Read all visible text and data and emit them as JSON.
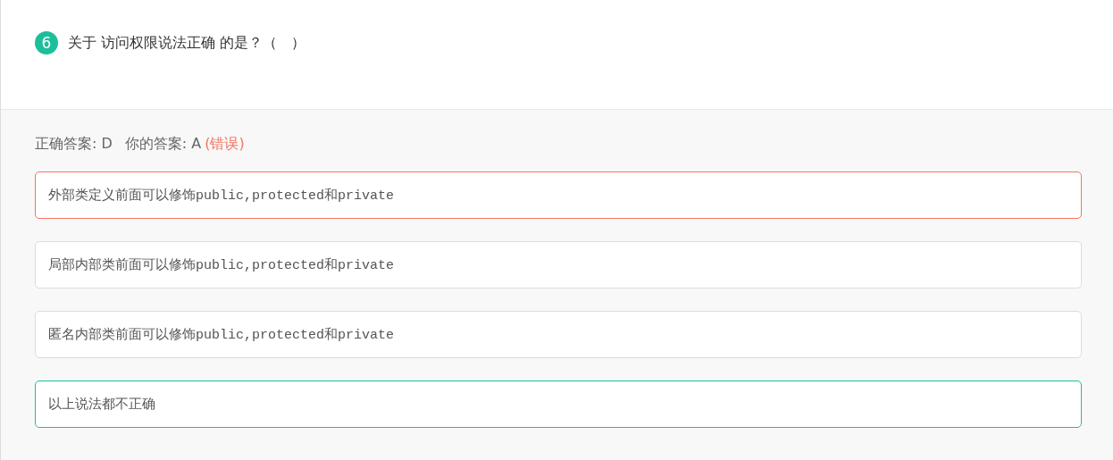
{
  "question": {
    "number": "6",
    "text": "关于 访问权限说法正确 的是？（　）"
  },
  "result": {
    "correct_answer": "正确答案: D",
    "your_answer": "你的答案: A",
    "verdict": "(错误)"
  },
  "options": [
    {
      "text": "外部类定义前面可以修饰public,protected和private",
      "kind": "wrong"
    },
    {
      "text": "局部内部类前面可以修饰public,protected和private",
      "kind": "plain"
    },
    {
      "text": "匿名内部类前面可以修饰public,protected和private",
      "kind": "plain"
    },
    {
      "text": "以上说法都不正确",
      "kind": "correct"
    }
  ]
}
